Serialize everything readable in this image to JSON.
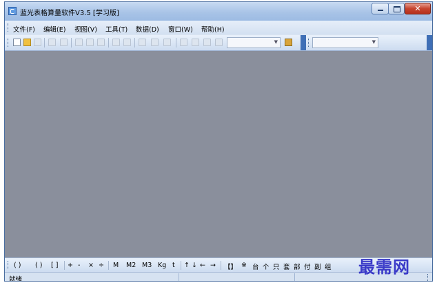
{
  "window": {
    "title": "蓝光表格算量软件V3.5 [学习版]"
  },
  "menu": [
    "文件(F)",
    "编辑(E)",
    "视图(V)",
    "工具(T)",
    "数据(D)",
    "窗口(W)",
    "帮助(H)"
  ],
  "toolbar": {
    "icons": [
      "new-file-icon",
      "open-folder-icon",
      "save-icon",
      "print-preview-icon",
      "print-icon",
      "cut-icon",
      "copy-icon",
      "paste-icon",
      "undo-icon",
      "redo-icon",
      "insert-row-icon",
      "insert-col-icon",
      "delete-row-icon",
      "edit-icon",
      "calc-icon",
      "sum-icon",
      "table-icon"
    ],
    "combo1_value": "",
    "combo2_value": ""
  },
  "symbols": [
    "( )",
    "( )",
    "[ ]",
    "+",
    "-",
    "×",
    "÷",
    "M",
    "M2",
    "M3",
    "Kg",
    "t",
    "↑",
    "↓",
    "←",
    "→",
    "【】",
    "※",
    "台",
    "个",
    "只",
    "套",
    "部",
    "付",
    "副",
    "组"
  ],
  "watermark": "最需网",
  "status": {
    "text": "就绪"
  },
  "colors": {
    "workspace": "#8a8f9c",
    "titlebar": "#a9c4e7",
    "close": "#c7452f"
  }
}
